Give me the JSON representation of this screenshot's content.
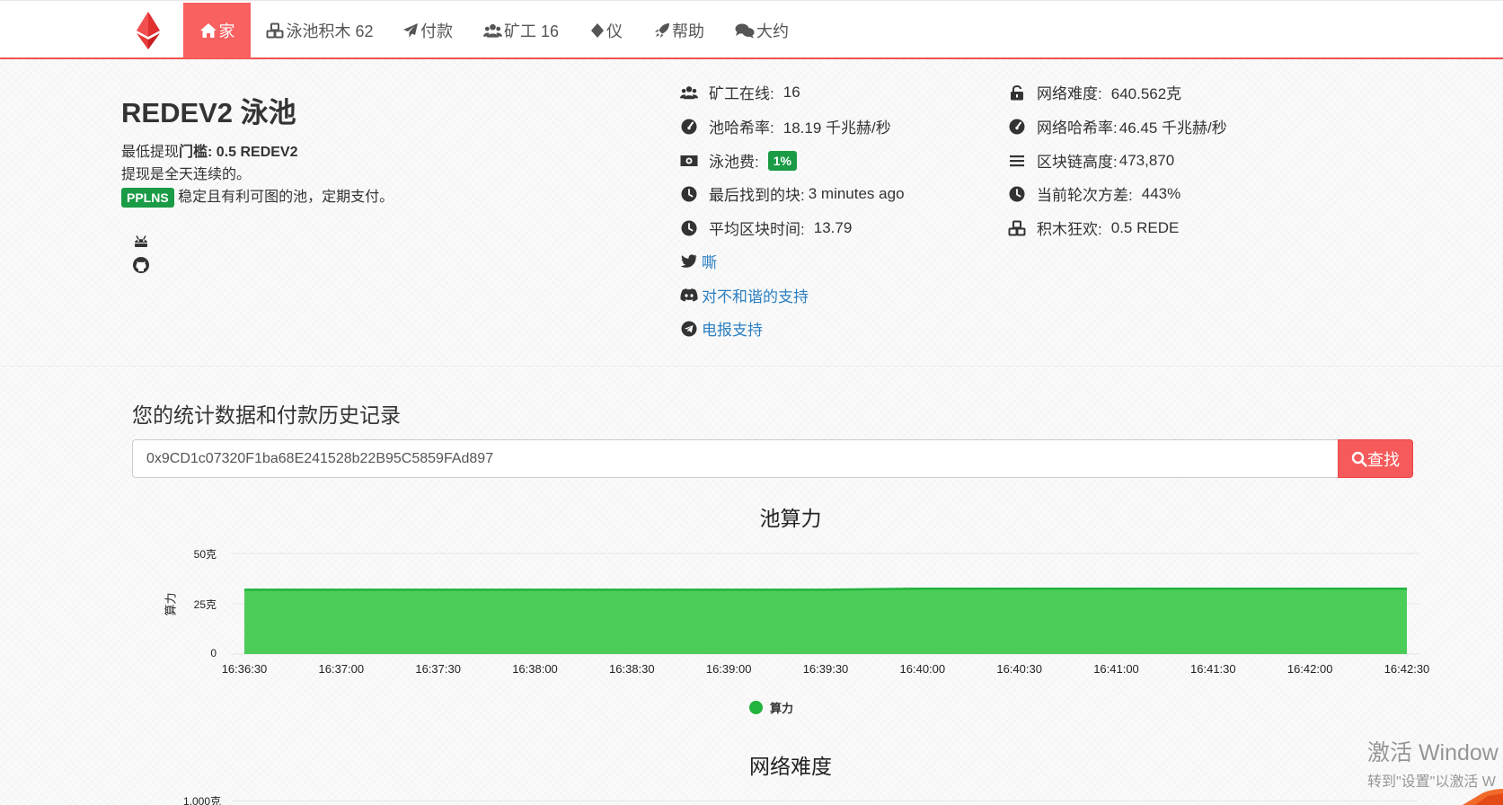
{
  "nav": {
    "home": "家",
    "pool_blocks": "泳池积木 62",
    "payments": "付款",
    "miners": "矿工 16",
    "instrument": "仪",
    "help": "帮助",
    "about": "大约"
  },
  "hero": {
    "title": "REDEV2 泳池",
    "min_payout_prefix": "最低提现",
    "min_payout_bold": "门槛:  0.5 REDEV2",
    "payout_note": "提现是全天连续的。",
    "scheme_badge": "PPLNS",
    "scheme_note": "稳定且有利可图的池，定期支付。"
  },
  "stats_left": [
    {
      "icon": "users-icon",
      "label": "矿工在线:",
      "value": "16"
    },
    {
      "icon": "tachometer-icon",
      "label": "池哈希率:",
      "value": "18.19 千兆赫/秒"
    },
    {
      "icon": "money-icon",
      "label": "泳池费:",
      "value": "1%"
    },
    {
      "icon": "clock-icon",
      "label": "最后找到的块:",
      "value": "3 minutes ago"
    },
    {
      "icon": "clock-icon",
      "label": "平均区块时间:",
      "value": "13.79"
    }
  ],
  "stats_right": [
    {
      "icon": "unlock-icon",
      "label": "网络难度:",
      "value": "640.562克"
    },
    {
      "icon": "tachometer-icon",
      "label": "网络哈希率:",
      "value": "46.45 千兆赫/秒"
    },
    {
      "icon": "bars-icon",
      "label": "区块链高度:",
      "value": "473,870"
    },
    {
      "icon": "clock-icon",
      "label": "当前轮次方差:",
      "value": "443%"
    },
    {
      "icon": "cubes-icon",
      "label": "积木狂欢:",
      "value": "0.5 REDE"
    }
  ],
  "links": {
    "twitter": "嘶",
    "discord": "对不和谐的支持",
    "telegram": "电报支持"
  },
  "lookup": {
    "title": "您的统计数据和付款历史记录",
    "address_value": "0x9CD1c07320F1ba68E241528b22B95C5859FAd897",
    "search_button": "查找"
  },
  "colors": {
    "accent": "#f96060",
    "badge_green": "#1a9b46",
    "chart_fill": "#4ccd5a",
    "chart_line": "#22b33c",
    "link": "#2c7fc1"
  },
  "chart_data": [
    {
      "type": "area",
      "title": "池算力",
      "ylabel": "算力",
      "x": [
        "16:36:30",
        "16:37:00",
        "16:37:30",
        "16:38:00",
        "16:38:30",
        "16:39:00",
        "16:39:30",
        "16:40:00",
        "16:40:30",
        "16:41:00",
        "16:41:30",
        "16:42:00",
        "16:42:30"
      ],
      "series": [
        {
          "name": "算力",
          "values": [
            32,
            32,
            32,
            32,
            32,
            32,
            32,
            32.5,
            32.5,
            32.5,
            32.5,
            32.5,
            32.5
          ]
        }
      ],
      "ytick_labels": [
        "0",
        "25克",
        "50克"
      ],
      "ytick_values": [
        0,
        25,
        50
      ],
      "ylim": [
        0,
        50
      ],
      "legend": "bottom-center",
      "grid": true
    },
    {
      "type": "line",
      "title": "网络难度",
      "ytick_labels": [
        "1,000克"
      ]
    }
  ],
  "watermark": {
    "line1": "激活 Window",
    "line2": "转到\"设置\"以激活 W"
  }
}
